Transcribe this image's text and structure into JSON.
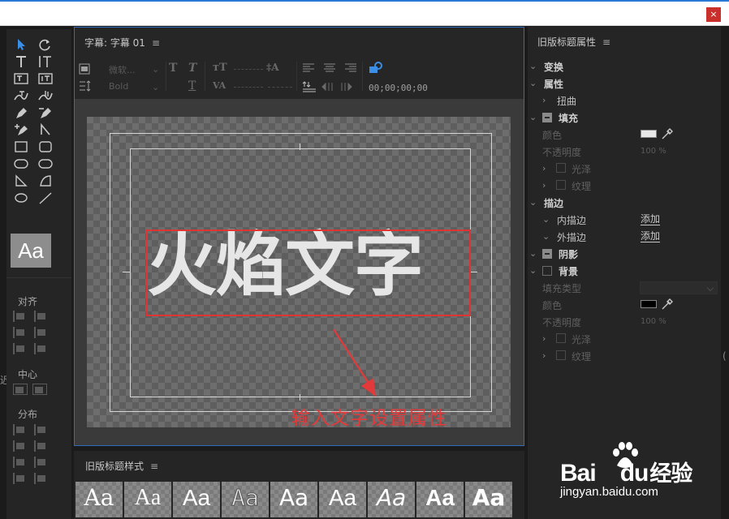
{
  "window": {
    "close_label": "×"
  },
  "tools_panel": {
    "preview_label": "Aa",
    "align_label": "对齐",
    "center_label": "中心",
    "distribute_label": "分布"
  },
  "title_panel": {
    "tab_label": "字幕: 字幕 01",
    "menu_icon": "≡",
    "font_family_placeholder": "微软...",
    "font_style_placeholder": "Bold",
    "timecode": "00;00;00;00",
    "title_text": "火焰文字",
    "annotation_text": "输入文字设置属性",
    "annotation_color": "#e23a3a"
  },
  "styles_panel": {
    "label": "旧版标题样式",
    "menu_icon": "≡",
    "swatches": [
      "Aa",
      "Aa",
      "Aa",
      "Aa",
      "Aa",
      "Aa",
      "Aa",
      "Aa",
      "Aa"
    ]
  },
  "props_panel": {
    "label": "旧版标题属性",
    "menu_icon": "≡",
    "transform": "变换",
    "properties": "属性",
    "distort": "扭曲",
    "fill": "填充",
    "color": "颜色",
    "opacity": "不透明度",
    "opacity_value": "100 %",
    "sheen": "光泽",
    "texture": "纹理",
    "stroke": "描边",
    "inner_stroke": "内描边",
    "outer_stroke": "外描边",
    "add": "添加",
    "shadow": "阴影",
    "background": "背景",
    "fill_type": "填充类型",
    "bg_color": "颜色",
    "bg_opacity": "不透明度",
    "bg_opacity_value": "100 %",
    "bg_sheen": "光泽",
    "bg_texture": "纹理",
    "fill_color": "#e8e8e8",
    "bg_fill_color": "#000000"
  },
  "watermark": {
    "brand_latin_1": "Bai",
    "brand_latin_2": "du",
    "brand_cn": "经验",
    "url": "jingyan.baidu.com"
  },
  "side_fragments": {
    "left": "迟",
    "right": "("
  }
}
